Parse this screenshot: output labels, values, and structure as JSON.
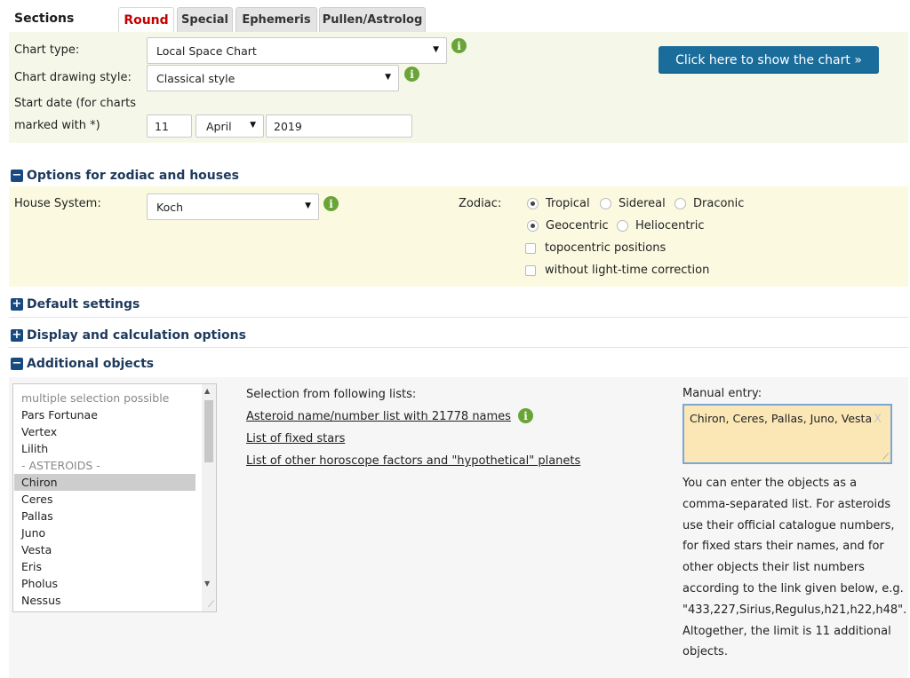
{
  "tabs": {
    "sections_label": "Sections",
    "items": [
      "Round",
      "Special",
      "Ephemeris",
      "Pullen/Astrolog"
    ]
  },
  "chart": {
    "chart_type_label": "Chart type:",
    "chart_type_value": "Local Space Chart",
    "drawing_style_label": "Chart drawing style:",
    "drawing_style_value": "Classical style",
    "start_date_label_1": "Start date (for charts",
    "start_date_label_2": "marked with *)",
    "day": "11",
    "month": "April",
    "year": "2019",
    "show_button": "Click here to show the chart »"
  },
  "zodiac_section": {
    "title": "Options for zodiac and houses",
    "house_system_label": "House System:",
    "house_system_value": "Koch",
    "zodiac_label": "Zodiac:",
    "zodiac_options": [
      "Tropical",
      "Sidereal",
      "Draconic"
    ],
    "zodiac_selected": "Tropical",
    "center_options": [
      "Geocentric",
      "Heliocentric"
    ],
    "center_selected": "Geocentric",
    "checkboxes": [
      "topocentric positions",
      "without light-time correction"
    ]
  },
  "collapsed_sections": [
    "Default settings",
    "Display and calculation options"
  ],
  "objects_section": {
    "title": "Additional objects",
    "list_items": [
      "multiple selection possible",
      "Pars Fortunae",
      "Vertex",
      "Lilith",
      "- ASTEROIDS -",
      "Chiron",
      "Ceres",
      "Pallas",
      "Juno",
      "Vesta",
      "Eris",
      "Pholus",
      "Nessus"
    ],
    "selected_item": "Chiron",
    "selection_label": "Selection from following lists:",
    "links": [
      "Asteroid name/number list with 21778 names",
      "List of fixed stars",
      "List of other horoscope factors and \"hypothetical\" planets"
    ],
    "manual_label": "Manual entry:",
    "manual_value": "Chiron, Ceres, Pallas, Juno, Vesta",
    "help_text": "You can enter the objects as a comma-separated list. For asteroids use their official catalogue numbers, for fixed stars their names, and for other objects their list numbers according to the link given below, e.g. \"433,227,Sirius,Regulus,h21,h22,h48\". Altogether, the limit is 11 additional objects."
  },
  "colors": {
    "accent_red": "#c40000",
    "button_blue": "#1a6c9b",
    "header_navy": "#1d3a5c",
    "info_green": "#6aa437",
    "chart_panel_bg": "#f5f8e9",
    "zodiac_panel_bg": "#fbfae1",
    "manual_entry_bg": "#fbe7b6"
  },
  "icons": {
    "info": "info-icon",
    "expand": "plus-square-icon",
    "collapse": "minus-square-icon",
    "clear": "close-icon"
  }
}
